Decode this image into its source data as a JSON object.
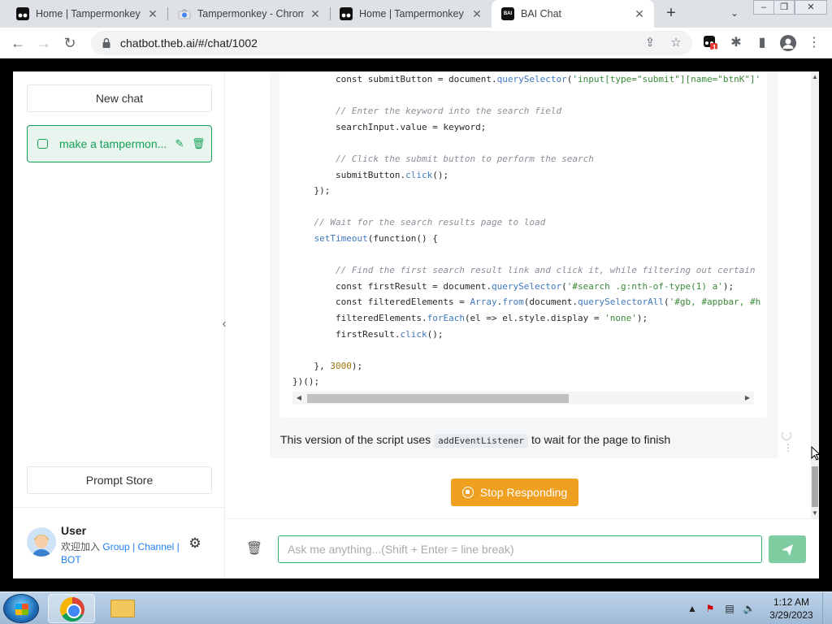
{
  "browser": {
    "tabs": [
      {
        "title": "Home | Tampermonkey",
        "favicon": "tampermonkey-icon",
        "active": false
      },
      {
        "title": "Tampermonkey - Chrome",
        "favicon": "chrome-webstore-icon",
        "active": false
      },
      {
        "title": "Home | Tampermonkey",
        "favicon": "tampermonkey-icon",
        "active": false
      },
      {
        "title": "BAI Chat",
        "favicon": "bai-chat-icon",
        "active": true
      }
    ],
    "url": "chatbot.theb.ai/#/chat/1002",
    "extension_badge": "1"
  },
  "sidebar": {
    "new_chat_label": "New chat",
    "chat_items": [
      {
        "title": "make a tampermon..."
      }
    ],
    "prompt_store_label": "Prompt Store",
    "user": {
      "name": "User",
      "join_text": "欢迎加入",
      "link_group": "Group",
      "link_channel": "Channel",
      "separator": "|",
      "link_bot": "BOT"
    }
  },
  "chat": {
    "code_lines": [
      "        const submitButton = document.querySelector('input[type=\"submit\"][name=\"btnK\"]'",
      "",
      "        // Enter the keyword into the search field",
      "        searchInput.value = keyword;",
      "",
      "        // Click the submit button to perform the search",
      "        submitButton.click();",
      "    });",
      "",
      "    // Wait for the search results page to load",
      "    setTimeout(function() {",
      "",
      "        // Find the first search result link and click it, while filtering out certain",
      "        const firstResult = document.querySelector('#search .g:nth-of-type(1) a');",
      "        const filteredElements = Array.from(document.querySelectorAll('#gb, #appbar, #h",
      "        filteredElements.forEach(el => el.style.display = 'none');",
      "        firstResult.click();",
      "",
      "    }, 3000);",
      "})();"
    ],
    "message_text_before": "This version of the script uses",
    "message_code": "addEventListener",
    "message_text_after": "to wait for the page to finish",
    "stop_button_label": "Stop Responding",
    "input_placeholder": "Ask me anything...(Shift + Enter = line break)",
    "input_value": ""
  },
  "taskbar": {
    "time": "1:12 AM",
    "date": "3/29/2023"
  },
  "colors": {
    "accent_green": "#18a058",
    "stop_orange": "#f0a020",
    "send_disabled": "#7fcca0"
  }
}
